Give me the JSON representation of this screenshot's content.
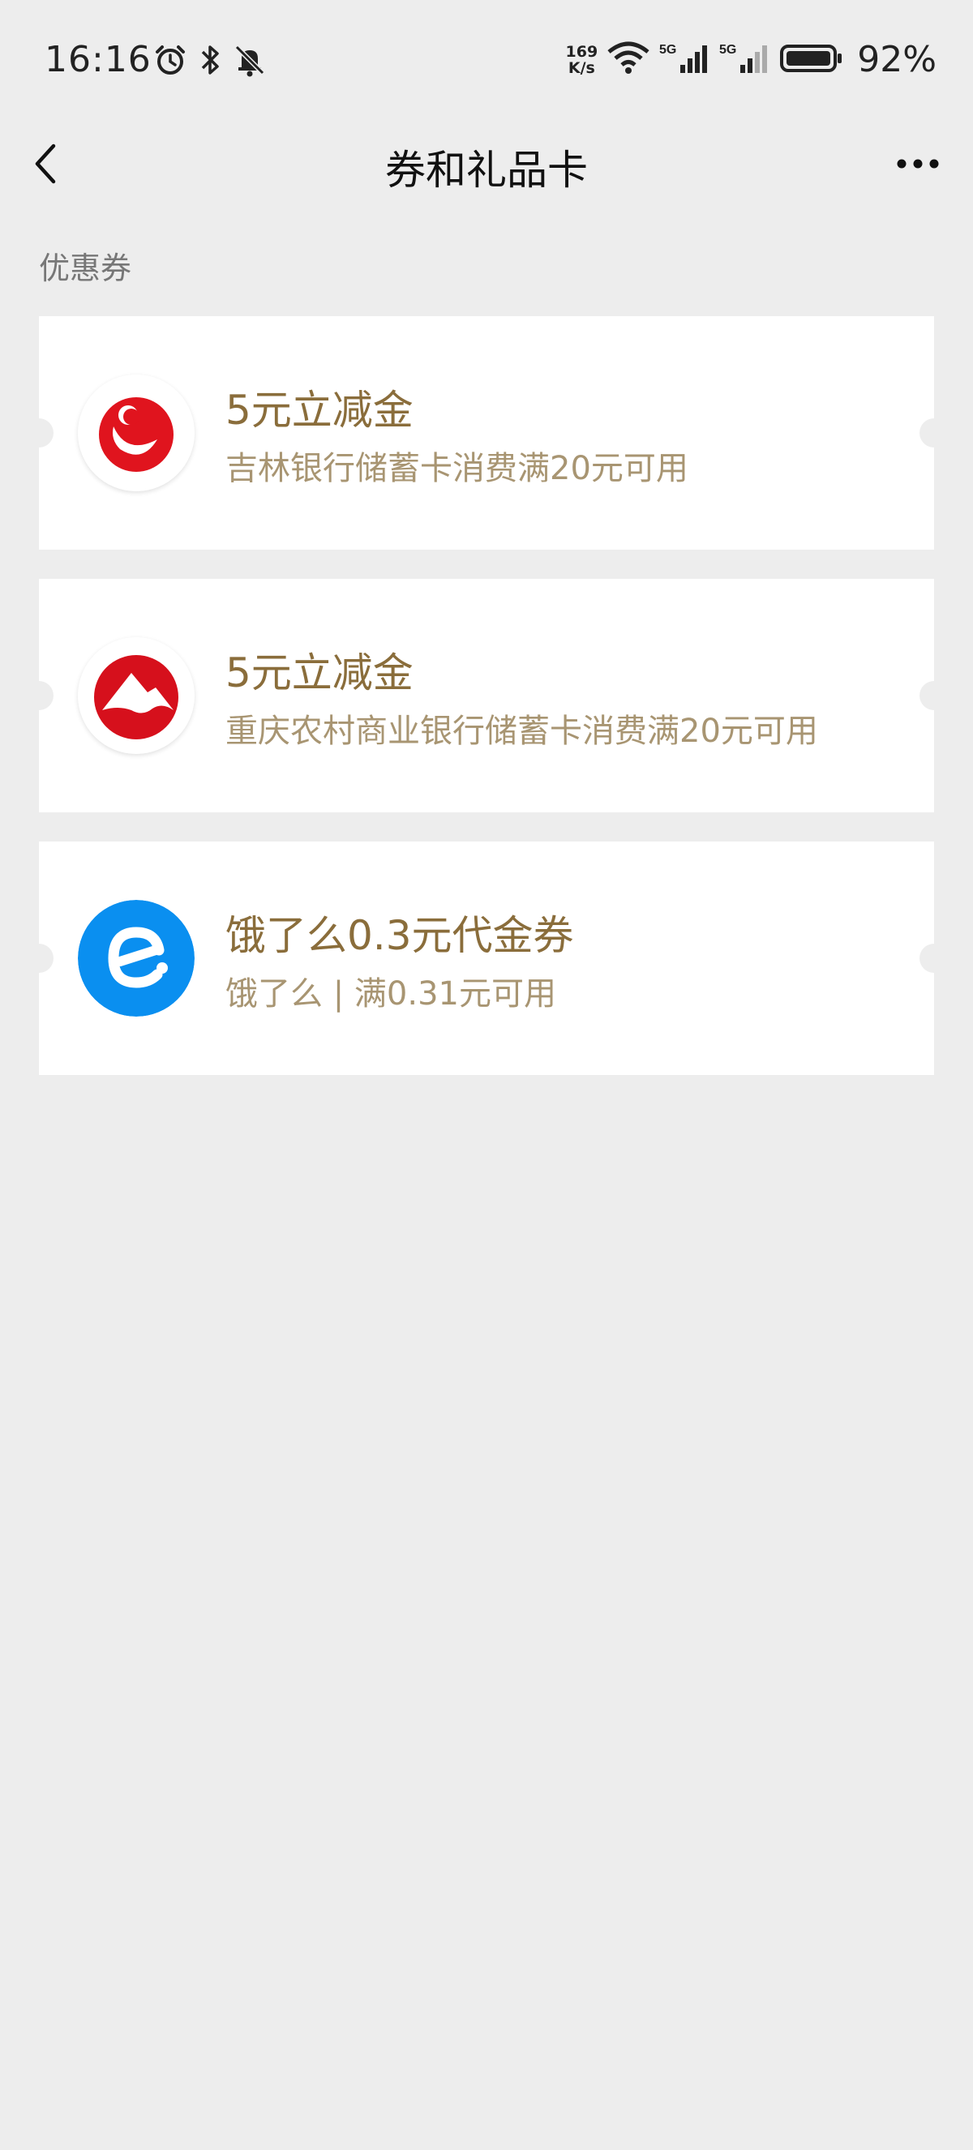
{
  "status_bar": {
    "time": "16:16",
    "net_speed_value": "169",
    "net_speed_unit": "K/s",
    "sim1_label": "5G",
    "sim2_label": "5G",
    "battery_percent": "92%",
    "icons": [
      "alarm-icon",
      "bluetooth-icon",
      "bell-off-icon",
      "wifi-icon",
      "signal-icon",
      "battery-icon"
    ]
  },
  "nav": {
    "title": "券和礼品卡",
    "back_icon": "chevron-left-icon",
    "more_icon": "more-horizontal-icon"
  },
  "section": {
    "title": "优惠券"
  },
  "coupons": [
    {
      "title": "5元立减金",
      "description": "吉林银行储蓄卡消费满20元可用",
      "logo": "jilin-bank-logo",
      "logo_color": "#e0141e"
    },
    {
      "title": "5元立减金",
      "description": "重庆农村商业银行储蓄卡消费满20元可用",
      "logo": "chongqing-rural-bank-logo",
      "logo_color": "#d6101c"
    },
    {
      "title": "饿了么0.3元代金券",
      "description": "饿了么 | 满0.31元可用",
      "logo": "eleme-logo",
      "logo_color": "#0a8ff0"
    }
  ],
  "colors": {
    "background": "#ededed",
    "card": "#ffffff",
    "title_gold": "#8a6d3b",
    "desc_gold": "#a89572"
  }
}
